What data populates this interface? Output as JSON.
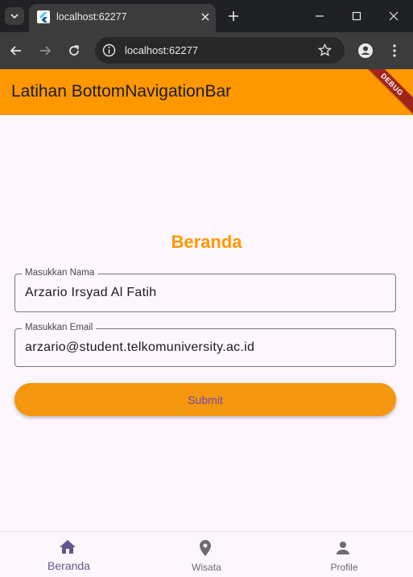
{
  "browser": {
    "tab": {
      "title": "localhost:62277"
    },
    "address": {
      "url": "localhost:62277"
    }
  },
  "app": {
    "title": "Latihan BottomNavigationBar",
    "debug_banner": "DEBUG",
    "page_heading": "Beranda",
    "form": {
      "name": {
        "label": "Masukkan Nama",
        "value": "Arzario Irsyad Al Fatih"
      },
      "email": {
        "label": "Masukkan Email",
        "value": "arzario@student.telkomuniversity.ac.id"
      },
      "submit_label": "Submit"
    },
    "bottom_nav": [
      {
        "label": "Beranda",
        "icon": "home-icon",
        "selected": true
      },
      {
        "label": "Wisata",
        "icon": "location-pin-icon",
        "selected": false
      },
      {
        "label": "Profile",
        "icon": "person-icon",
        "selected": false
      }
    ]
  },
  "colors": {
    "appbar": "#ff9800",
    "accent_heading": "#ff9800",
    "submit_bg": "#f5960f",
    "nav_selected": "#65558f",
    "nav_unselected": "#6d6a72"
  }
}
